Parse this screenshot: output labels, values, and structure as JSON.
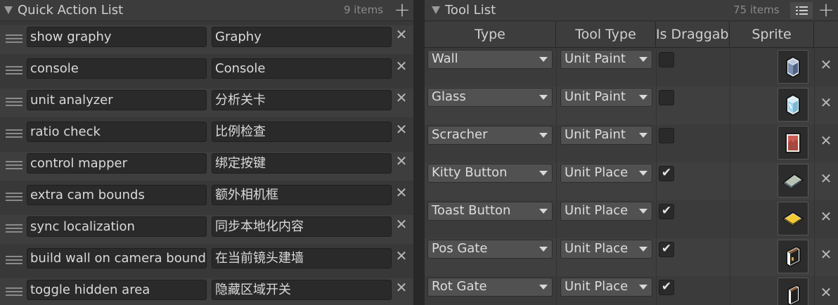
{
  "quick_action_list": {
    "title": "Quick Action List",
    "count": "9 items",
    "add_label": "+",
    "remove_label": "✕",
    "items": [
      {
        "command": "show graphy",
        "name": "Graphy"
      },
      {
        "command": "console",
        "name": "Console"
      },
      {
        "command": "unit analyzer",
        "name": "分析关卡"
      },
      {
        "command": "ratio check",
        "name": "比例检查"
      },
      {
        "command": "control mapper",
        "name": "绑定按键"
      },
      {
        "command": "extra cam bounds",
        "name": "额外相机框"
      },
      {
        "command": "sync localization",
        "name": "同步本地化内容"
      },
      {
        "command": "build wall on camera bound",
        "name": "在当前镜头建墙"
      },
      {
        "command": "toggle hidden area",
        "name": "隐藏区域开关"
      }
    ]
  },
  "tool_list": {
    "title": "Tool List",
    "count": "75 items",
    "add_label": "+",
    "remove_label": "✕",
    "columns": [
      "Type",
      "Tool Type",
      "Is Draggable",
      "Sprite"
    ],
    "rows": [
      {
        "type": "Wall",
        "tool_type": "Unit Paint",
        "draggable": false,
        "checkmark": "",
        "sprite": "wall-sprite-icon"
      },
      {
        "type": "Glass",
        "tool_type": "Unit Paint",
        "draggable": false,
        "checkmark": "",
        "sprite": "glass-sprite-icon"
      },
      {
        "type": "Scracher",
        "tool_type": "Unit Paint",
        "draggable": false,
        "checkmark": "",
        "sprite": "scracher-sprite-icon"
      },
      {
        "type": "Kitty Button",
        "tool_type": "Unit Place",
        "draggable": true,
        "checkmark": "✔",
        "sprite": "kitty-button-sprite-icon"
      },
      {
        "type": "Toast Button",
        "tool_type": "Unit Place",
        "draggable": true,
        "checkmark": "✔",
        "sprite": "toast-button-sprite-icon"
      },
      {
        "type": "Pos Gate",
        "tool_type": "Unit Place",
        "draggable": true,
        "checkmark": "✔",
        "sprite": "pos-gate-sprite-icon"
      },
      {
        "type": "Rot Gate",
        "tool_type": "Unit Place",
        "draggable": true,
        "checkmark": "✔",
        "sprite": "rot-gate-sprite-icon"
      }
    ]
  }
}
